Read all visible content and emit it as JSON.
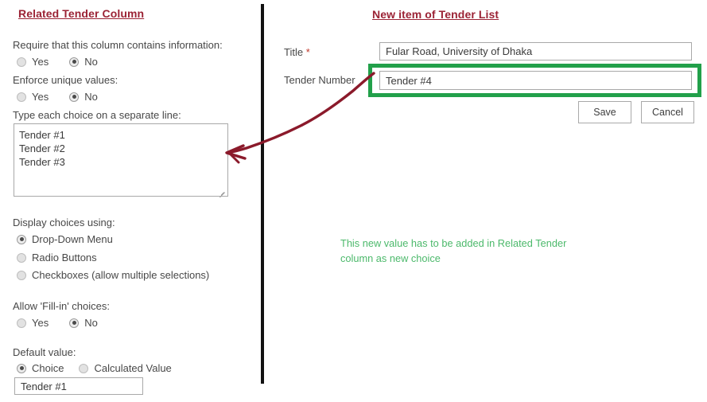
{
  "left_panel": {
    "heading": "Related Tender Column",
    "require_info": {
      "label": "Require that this column contains information:",
      "options": [
        {
          "label": "Yes",
          "selected": false
        },
        {
          "label": "No",
          "selected": true
        }
      ]
    },
    "enforce_unique": {
      "label": "Enforce unique values:",
      "options": [
        {
          "label": "Yes",
          "selected": false
        },
        {
          "label": "No",
          "selected": true
        }
      ]
    },
    "choices": {
      "label": "Type each choice on a separate line:",
      "lines": [
        "Tender #1",
        "Tender #2",
        "Tender #3"
      ]
    },
    "display_choices": {
      "label": "Display choices using:",
      "options": [
        {
          "label": "Drop-Down Menu",
          "selected": true
        },
        {
          "label": "Radio Buttons",
          "selected": false
        },
        {
          "label": "Checkboxes (allow multiple selections)",
          "selected": false
        }
      ]
    },
    "fill_in": {
      "label": "Allow 'Fill-in' choices:",
      "options": [
        {
          "label": "Yes",
          "selected": false
        },
        {
          "label": "No",
          "selected": true
        }
      ]
    },
    "default_value": {
      "label": "Default value:",
      "options": [
        {
          "label": "Choice",
          "selected": true
        },
        {
          "label": "Calculated Value",
          "selected": false
        }
      ],
      "input_value": "Tender #1"
    }
  },
  "right_panel": {
    "heading": "New item of Tender List",
    "fields": {
      "title": {
        "label": "Title",
        "required_marker": "*",
        "value": "Fular Road, University of Dhaka"
      },
      "tender_number": {
        "label": "Tender Number",
        "value": "Tender #4"
      }
    },
    "buttons": {
      "save": "Save",
      "cancel": "Cancel"
    }
  },
  "annotations": {
    "note_text": "This new value has to be added in Related Tender column as new choice",
    "note_color": "#4CB96B",
    "highlight_color": "#22A04A",
    "arrow_color": "#8B1A2B",
    "divider_color": "#111111",
    "heading_color": "#9B2335"
  }
}
